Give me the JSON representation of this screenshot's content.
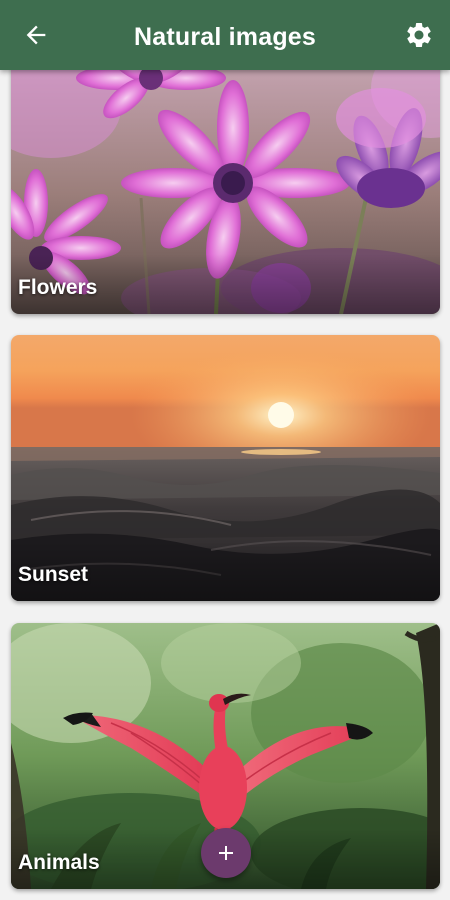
{
  "app_bar": {
    "title": "Natural images",
    "background_color": "#3e6e4f",
    "back_icon": "arrow-back-icon",
    "settings_icon": "gear-icon"
  },
  "categories": [
    {
      "label": "Flowers",
      "image": "purple-daisy-flowers-photo"
    },
    {
      "label": "Sunset",
      "image": "sunset-over-ocean-waves-photo"
    },
    {
      "label": "Animals",
      "image": "scarlet-ibis-bird-photo"
    }
  ],
  "fab": {
    "icon": "plus-icon",
    "color": "#6c3a6d"
  }
}
